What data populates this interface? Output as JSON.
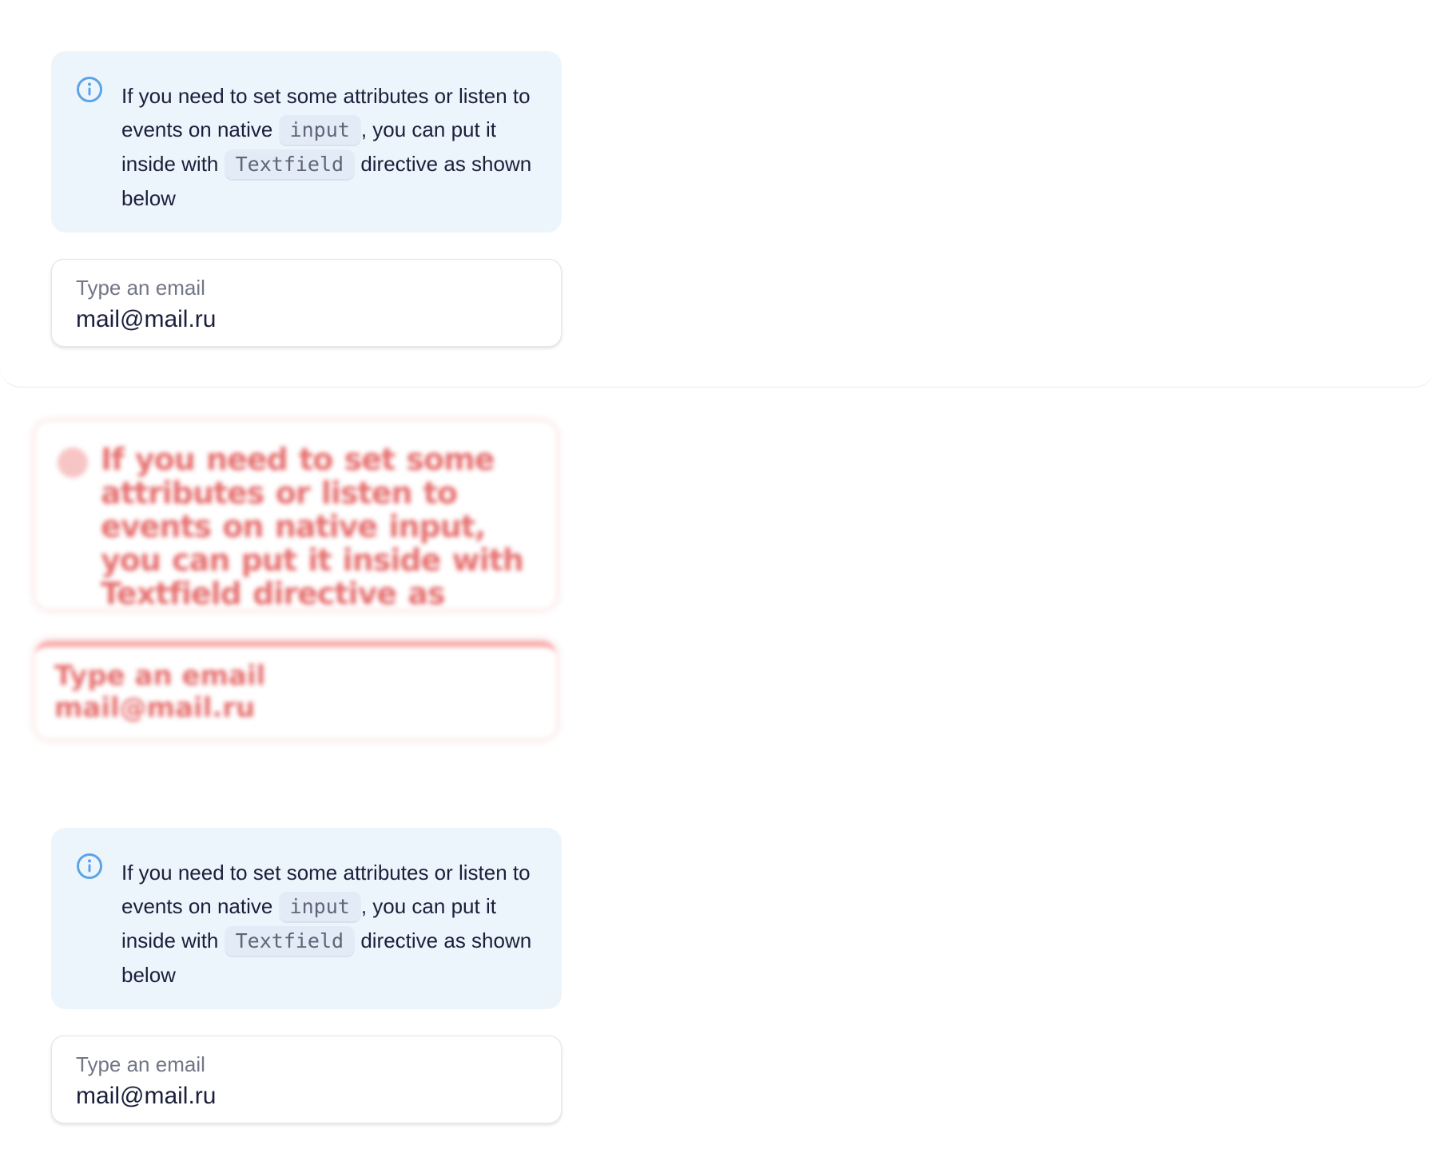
{
  "examples": [
    {
      "notification": {
        "icon": "info-icon",
        "text_before_input": "If you need to set some attributes or listen to events on native ",
        "code_input": "input",
        "text_middle": ", you can put it inside with ",
        "code_textfield": "Textfield",
        "text_after": " directive as shown below"
      },
      "field": {
        "label": "Type an email",
        "value": "mail@mail.ru"
      }
    },
    {
      "notification": {
        "icon": "info-icon",
        "text_before_input": "If you need to set some attributes or listen to events on native ",
        "code_input": "input",
        "text_middle": ", you can put it inside with ",
        "code_textfield": "Textfield",
        "text_after": " directive as shown below"
      },
      "field": {
        "label": "Type an email",
        "value": "mail@mail.ru"
      }
    }
  ],
  "colors": {
    "notification_bg": "#edf5fc",
    "info_icon": "#5ba4e6",
    "diff_ghost": "#e14a4a"
  }
}
